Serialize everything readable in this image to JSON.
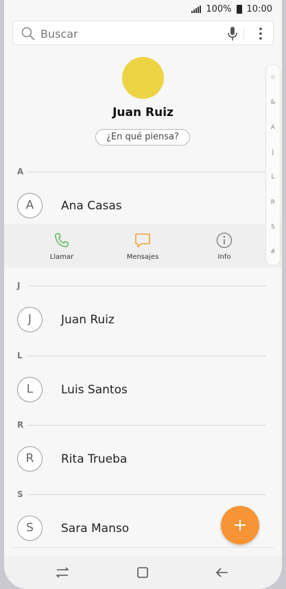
{
  "status_bar": {
    "battery": "100%",
    "time": "10:00"
  },
  "search": {
    "placeholder": "Buscar"
  },
  "profile": {
    "name": "Juan Ruiz",
    "status_button": "¿En qué piensa?"
  },
  "sections": [
    {
      "letter": "A",
      "contacts": [
        {
          "initial": "A",
          "name": "Ana Casas"
        }
      ]
    },
    {
      "letter": "J",
      "contacts": [
        {
          "initial": "J",
          "name": "Juan Ruiz"
        }
      ]
    },
    {
      "letter": "L",
      "contacts": [
        {
          "initial": "L",
          "name": "Luis Santos"
        }
      ]
    },
    {
      "letter": "R",
      "contacts": [
        {
          "initial": "R",
          "name": "Rita Trueba"
        }
      ]
    },
    {
      "letter": "S",
      "contacts": [
        {
          "initial": "S",
          "name": "Sara Manso"
        }
      ]
    }
  ],
  "expanded_actions": [
    {
      "label": "Llamar",
      "icon": "phone-icon",
      "color": "#5cb85c"
    },
    {
      "label": "Mensajes",
      "icon": "message-icon",
      "color": "#f3a33a"
    },
    {
      "label": "Info",
      "icon": "info-icon",
      "color": "#777777"
    }
  ],
  "index": [
    "☆",
    "&",
    "A",
    "J",
    "L",
    "R",
    "S",
    "#"
  ],
  "colors": {
    "accent": "#f79435",
    "profile_avatar": "#ecd444"
  }
}
